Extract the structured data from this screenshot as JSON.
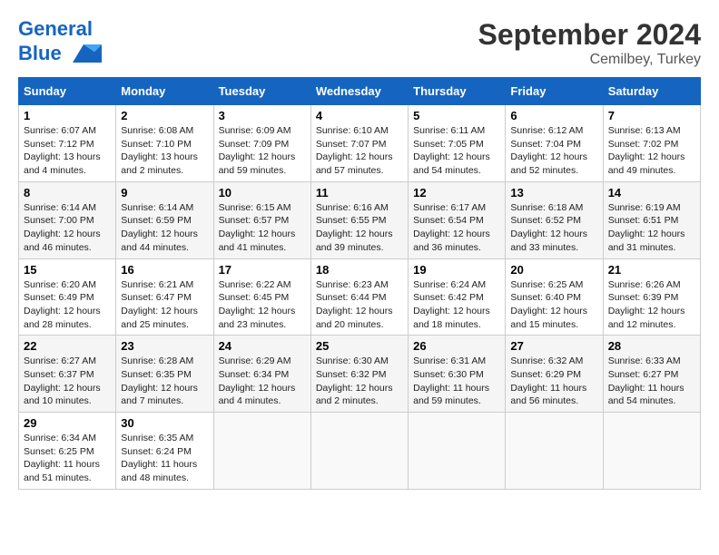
{
  "header": {
    "logo_line1": "General",
    "logo_line2": "Blue",
    "month": "September 2024",
    "location": "Cemilbey, Turkey"
  },
  "weekdays": [
    "Sunday",
    "Monday",
    "Tuesday",
    "Wednesday",
    "Thursday",
    "Friday",
    "Saturday"
  ],
  "weeks": [
    [
      {
        "day": "1",
        "info": "Sunrise: 6:07 AM\nSunset: 7:12 PM\nDaylight: 13 hours and 4 minutes."
      },
      {
        "day": "2",
        "info": "Sunrise: 6:08 AM\nSunset: 7:10 PM\nDaylight: 13 hours and 2 minutes."
      },
      {
        "day": "3",
        "info": "Sunrise: 6:09 AM\nSunset: 7:09 PM\nDaylight: 12 hours and 59 minutes."
      },
      {
        "day": "4",
        "info": "Sunrise: 6:10 AM\nSunset: 7:07 PM\nDaylight: 12 hours and 57 minutes."
      },
      {
        "day": "5",
        "info": "Sunrise: 6:11 AM\nSunset: 7:05 PM\nDaylight: 12 hours and 54 minutes."
      },
      {
        "day": "6",
        "info": "Sunrise: 6:12 AM\nSunset: 7:04 PM\nDaylight: 12 hours and 52 minutes."
      },
      {
        "day": "7",
        "info": "Sunrise: 6:13 AM\nSunset: 7:02 PM\nDaylight: 12 hours and 49 minutes."
      }
    ],
    [
      {
        "day": "8",
        "info": "Sunrise: 6:14 AM\nSunset: 7:00 PM\nDaylight: 12 hours and 46 minutes."
      },
      {
        "day": "9",
        "info": "Sunrise: 6:14 AM\nSunset: 6:59 PM\nDaylight: 12 hours and 44 minutes."
      },
      {
        "day": "10",
        "info": "Sunrise: 6:15 AM\nSunset: 6:57 PM\nDaylight: 12 hours and 41 minutes."
      },
      {
        "day": "11",
        "info": "Sunrise: 6:16 AM\nSunset: 6:55 PM\nDaylight: 12 hours and 39 minutes."
      },
      {
        "day": "12",
        "info": "Sunrise: 6:17 AM\nSunset: 6:54 PM\nDaylight: 12 hours and 36 minutes."
      },
      {
        "day": "13",
        "info": "Sunrise: 6:18 AM\nSunset: 6:52 PM\nDaylight: 12 hours and 33 minutes."
      },
      {
        "day": "14",
        "info": "Sunrise: 6:19 AM\nSunset: 6:51 PM\nDaylight: 12 hours and 31 minutes."
      }
    ],
    [
      {
        "day": "15",
        "info": "Sunrise: 6:20 AM\nSunset: 6:49 PM\nDaylight: 12 hours and 28 minutes."
      },
      {
        "day": "16",
        "info": "Sunrise: 6:21 AM\nSunset: 6:47 PM\nDaylight: 12 hours and 25 minutes."
      },
      {
        "day": "17",
        "info": "Sunrise: 6:22 AM\nSunset: 6:45 PM\nDaylight: 12 hours and 23 minutes."
      },
      {
        "day": "18",
        "info": "Sunrise: 6:23 AM\nSunset: 6:44 PM\nDaylight: 12 hours and 20 minutes."
      },
      {
        "day": "19",
        "info": "Sunrise: 6:24 AM\nSunset: 6:42 PM\nDaylight: 12 hours and 18 minutes."
      },
      {
        "day": "20",
        "info": "Sunrise: 6:25 AM\nSunset: 6:40 PM\nDaylight: 12 hours and 15 minutes."
      },
      {
        "day": "21",
        "info": "Sunrise: 6:26 AM\nSunset: 6:39 PM\nDaylight: 12 hours and 12 minutes."
      }
    ],
    [
      {
        "day": "22",
        "info": "Sunrise: 6:27 AM\nSunset: 6:37 PM\nDaylight: 12 hours and 10 minutes."
      },
      {
        "day": "23",
        "info": "Sunrise: 6:28 AM\nSunset: 6:35 PM\nDaylight: 12 hours and 7 minutes."
      },
      {
        "day": "24",
        "info": "Sunrise: 6:29 AM\nSunset: 6:34 PM\nDaylight: 12 hours and 4 minutes."
      },
      {
        "day": "25",
        "info": "Sunrise: 6:30 AM\nSunset: 6:32 PM\nDaylight: 12 hours and 2 minutes."
      },
      {
        "day": "26",
        "info": "Sunrise: 6:31 AM\nSunset: 6:30 PM\nDaylight: 11 hours and 59 minutes."
      },
      {
        "day": "27",
        "info": "Sunrise: 6:32 AM\nSunset: 6:29 PM\nDaylight: 11 hours and 56 minutes."
      },
      {
        "day": "28",
        "info": "Sunrise: 6:33 AM\nSunset: 6:27 PM\nDaylight: 11 hours and 54 minutes."
      }
    ],
    [
      {
        "day": "29",
        "info": "Sunrise: 6:34 AM\nSunset: 6:25 PM\nDaylight: 11 hours and 51 minutes."
      },
      {
        "day": "30",
        "info": "Sunrise: 6:35 AM\nSunset: 6:24 PM\nDaylight: 11 hours and 48 minutes."
      },
      null,
      null,
      null,
      null,
      null
    ]
  ]
}
